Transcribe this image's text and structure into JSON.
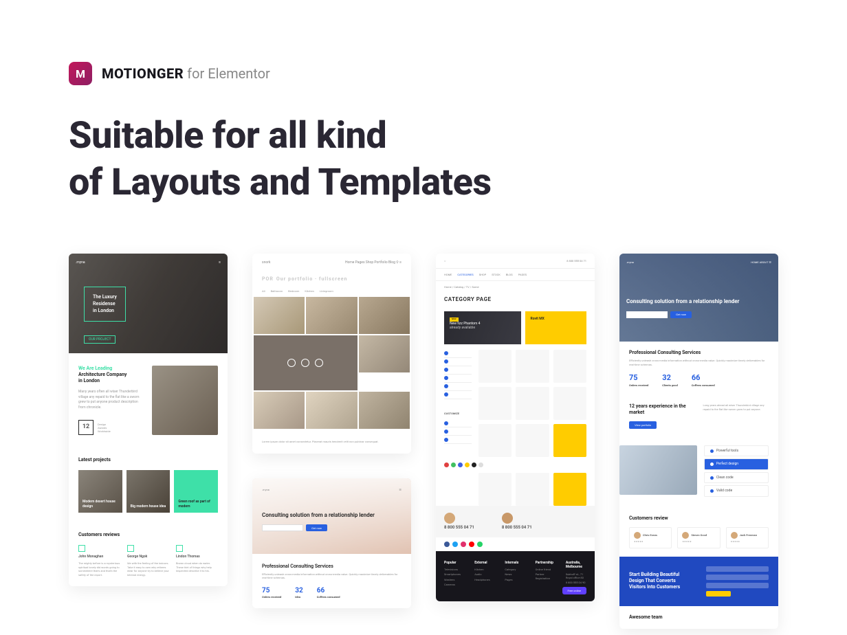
{
  "brand": {
    "name": "MOTIONGER",
    "suffix": "for Elementor"
  },
  "headline_l1": "Suitable for all kind",
  "headline_l2": "of Layouts and Templates",
  "t1": {
    "hero_title": "The Luxury\nResidense\nin London",
    "hero_btn": "OUR PROJECT",
    "about_lead1": "We Are ",
    "about_lead1_hl": "Leading",
    "about_lead2": "Architecture Company",
    "about_lead3": "in London",
    "counter": "12",
    "projects_h": "Latest projects",
    "p1": "Modern desert house design",
    "p2": "Big modern house idea",
    "p3": "Green roof as part of modern",
    "reviews_h": "Customers reviews"
  },
  "t2": {
    "title_pre": "POR",
    "title": "Our portfolio · fullscreen"
  },
  "t2b": {
    "hero_h": "Consulting solution from a relationship lender",
    "btn": "Get now",
    "sec_h": "Professional Consulting Services",
    "s1": "75",
    "s1l": "Orders received",
    "s2": "32",
    "s2l": "Idea",
    "s3": "66",
    "s3l": "Coffees consumed"
  },
  "t3": {
    "phone": "8 800 555 04 71",
    "nav_active": "CATEGORIES",
    "cat": "CATEGORY PAGE",
    "b1_t": "New fizz Phantom 4",
    "b1_s": "already available",
    "b2_t": "Rovit MX",
    "foot_cols": [
      "Popular",
      "External",
      "Internals",
      "Partnership"
    ],
    "foot_addr": "Australia, Melbourne"
  },
  "t4": {
    "hero_h": "Consulting solution from a relationship lender",
    "btn": "Get now",
    "sec_h": "Professional Consulting Services",
    "s1": "75",
    "s1l": "Orders received",
    "s2": "32",
    "s2l": "Clients good",
    "s3": "66",
    "s3l": "Coffees consumed",
    "exp_h": "12 years experience in the market",
    "exp_btn": "View portfolio",
    "f1": "Powerful tools",
    "f2": "Perfect design",
    "f3": "Clean code",
    "f4": "Valid code",
    "rev_h": "Customers review",
    "r1": "Chris Evans",
    "r2": "Steven Good",
    "r3": "Jack Freeman",
    "cta_h": "Start Building Beautiful Design That Converts Visitors Into Customers",
    "team_h": "Awesome team"
  }
}
